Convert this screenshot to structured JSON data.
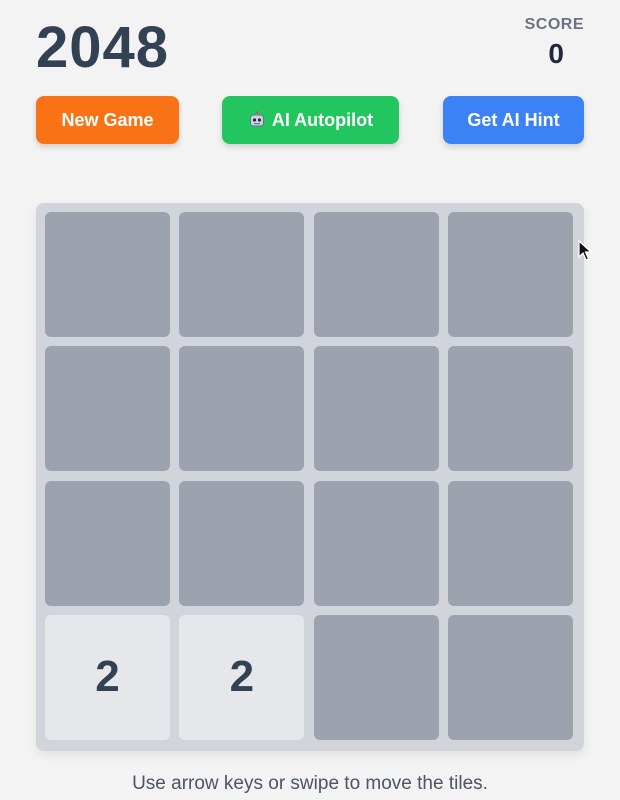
{
  "header": {
    "title": "2048",
    "score_label": "SCORE",
    "score_value": "0"
  },
  "buttons": {
    "new_game": "New Game",
    "autopilot": "AI Autopilot",
    "autopilot_icon": "robot-icon",
    "hint": "Get AI Hint"
  },
  "colors": {
    "new_game": "#f97316",
    "autopilot": "#22c55e",
    "hint": "#3b82f6",
    "empty_tile": "#9ca3af",
    "tile_2": "#e5e7eb",
    "board": "#d1d5db"
  },
  "board": {
    "rows": [
      [
        "",
        "",
        "",
        ""
      ],
      [
        "",
        "",
        "",
        ""
      ],
      [
        "",
        "",
        "",
        ""
      ],
      [
        "2",
        "2",
        "",
        ""
      ]
    ]
  },
  "footer": {
    "instructions": "Use arrow keys or swipe to move the tiles."
  }
}
